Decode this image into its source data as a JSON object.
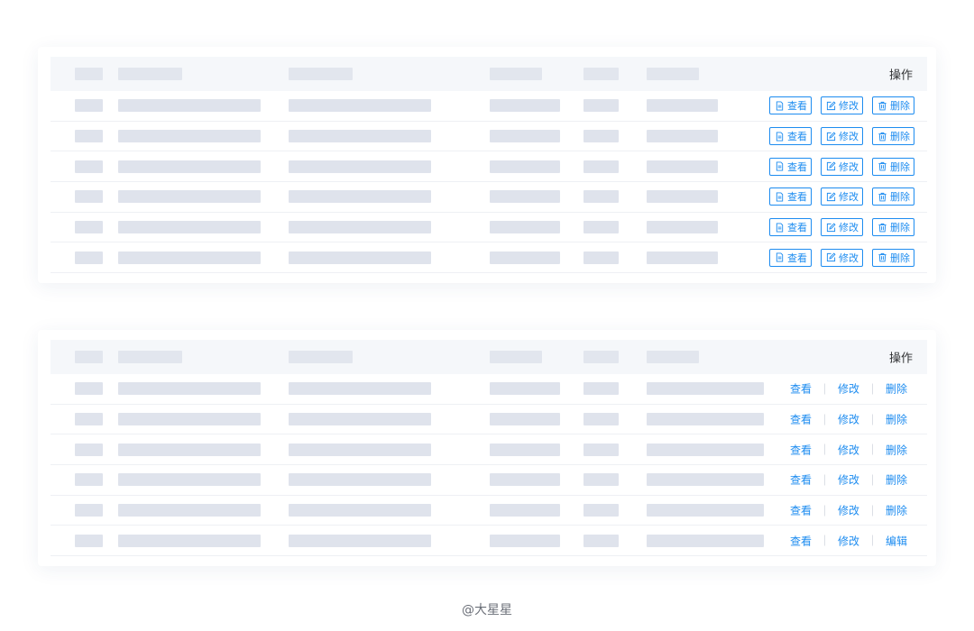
{
  "table_bordered": {
    "header": {
      "operation_label": "操作"
    },
    "actions": [
      {
        "label": "查看",
        "icon": "document-icon"
      },
      {
        "label": "修改",
        "icon": "edit-icon"
      },
      {
        "label": "删除",
        "icon": "trash-icon"
      }
    ],
    "row_count": 6
  },
  "table_links": {
    "header": {
      "operation_label": "操作"
    },
    "rows": [
      {
        "view": "查看",
        "edit": "修改",
        "third": "删除"
      },
      {
        "view": "查看",
        "edit": "修改",
        "third": "删除"
      },
      {
        "view": "查看",
        "edit": "修改",
        "third": "删除"
      },
      {
        "view": "查看",
        "edit": "修改",
        "third": "删除"
      },
      {
        "view": "查看",
        "edit": "修改",
        "third": "删除"
      },
      {
        "view": "查看",
        "edit": "修改",
        "third": "编辑"
      }
    ]
  },
  "footer": {
    "credit": "@大星星"
  },
  "colors": {
    "primary": "#1d8cf0",
    "placeholder": "#dfe3ec",
    "header_bg": "#f5f7fa"
  }
}
